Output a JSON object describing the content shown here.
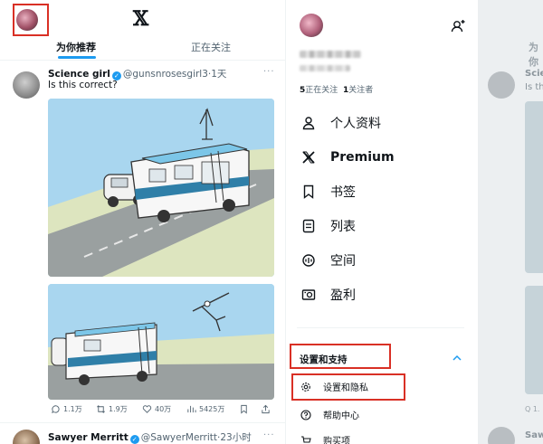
{
  "header": {
    "logo": "𝕏",
    "tabs": [
      "为你推荐",
      "正在关注"
    ]
  },
  "posts": [
    {
      "name": "Science girl",
      "handle": "@gunsnrosesgirl3",
      "time": "·1天",
      "text": "Is this correct?",
      "stats": {
        "replies": "1.1万",
        "reposts": "1.9万",
        "likes": "40万",
        "views": "5425万"
      }
    },
    {
      "name": "Sawyer Merritt",
      "handle": "@SawyerMerritt",
      "time": "·23小时"
    }
  ],
  "drawer": {
    "following_count": "5",
    "following_label": "正在关注",
    "followers_count": "1",
    "followers_label": "关注者",
    "menu": [
      {
        "label": "个人资料",
        "icon": "profile-icon"
      },
      {
        "label": "Premium",
        "icon": "x-icon"
      },
      {
        "label": "书签",
        "icon": "bookmark-icon"
      },
      {
        "label": "列表",
        "icon": "list-icon"
      },
      {
        "label": "空间",
        "icon": "spaces-icon"
      },
      {
        "label": "盈利",
        "icon": "monetization-icon"
      }
    ],
    "section_title": "设置和支持",
    "sub_items": [
      {
        "label": "设置和隐私",
        "icon": "gear-icon"
      },
      {
        "label": "帮助中心",
        "icon": "help-icon"
      },
      {
        "label": "购买项",
        "icon": "cart-icon"
      }
    ]
  },
  "background": {
    "tab": "为你",
    "name": "Scie",
    "text": "Is th",
    "name2": "Saw",
    "stat": "Q 1."
  },
  "colors": {
    "accent": "#1d9bf0",
    "highlight": "#d93025"
  }
}
